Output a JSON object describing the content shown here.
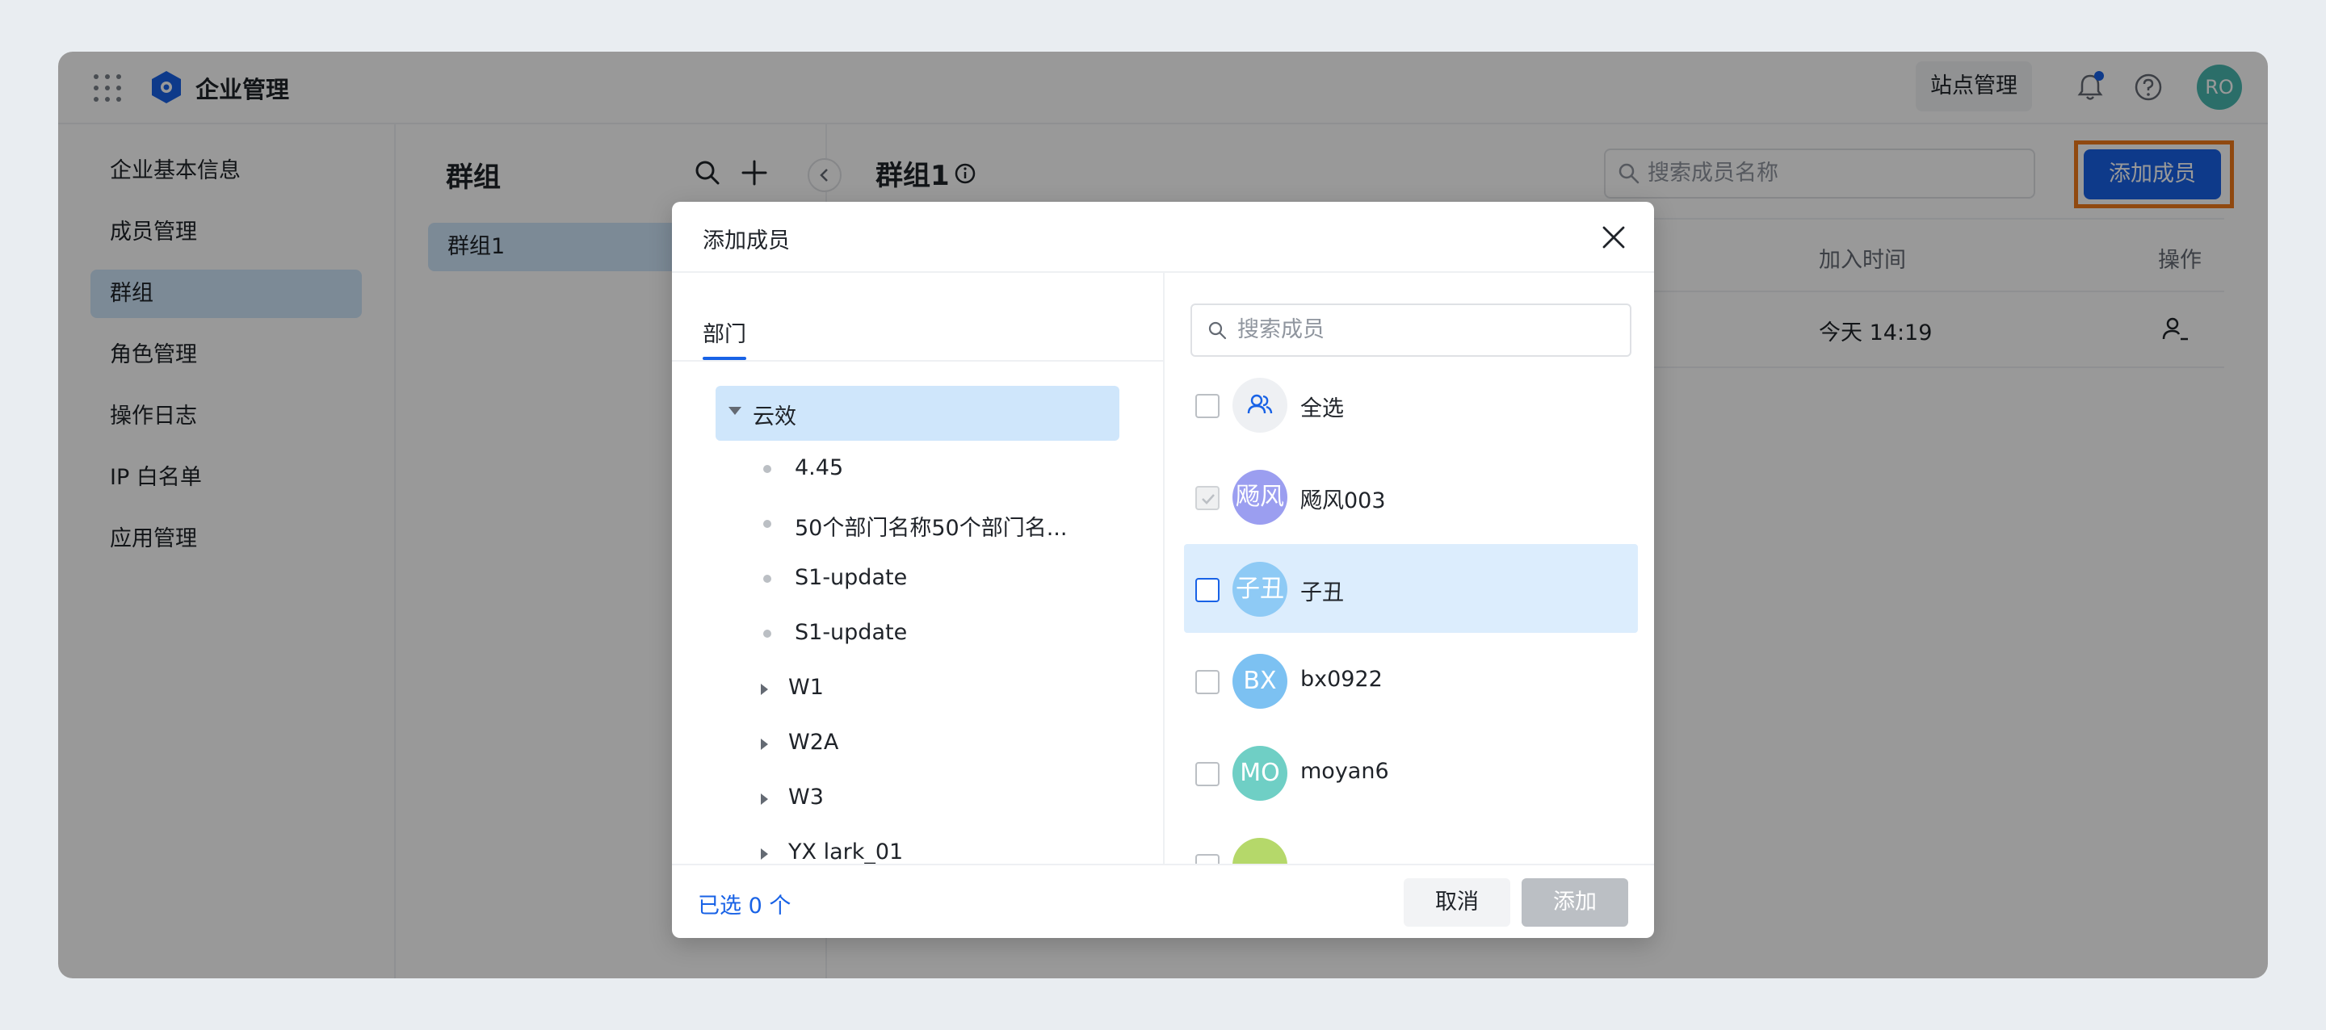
{
  "header": {
    "app_title": "企业管理",
    "site_button": "站点管理",
    "avatar_initials": "RO",
    "avatar_color": "#48b8b0",
    "brand_color": "#1862e6"
  },
  "sidebar": {
    "items": [
      {
        "label": "企业基本信息"
      },
      {
        "label": "成员管理"
      },
      {
        "label": "群组"
      },
      {
        "label": "角色管理"
      },
      {
        "label": "操作日志"
      },
      {
        "label": "IP 白名单"
      },
      {
        "label": "应用管理"
      }
    ],
    "active_index": 2
  },
  "groups": {
    "title": "群组",
    "items": [
      {
        "label": "群组1"
      }
    ]
  },
  "main": {
    "title": "群组1",
    "search_placeholder": "搜索成员名称",
    "add_member_button": "添加成员",
    "columns": {
      "join_time": "加入时间",
      "action": "操作"
    },
    "rows": [
      {
        "join_time": "今天 14:19"
      }
    ]
  },
  "modal": {
    "title": "添加成员",
    "tab_label": "部门",
    "tree": {
      "root": "云效",
      "children": [
        {
          "label": "4.45",
          "type": "leaf"
        },
        {
          "label": "50个部门名称50个部门名...",
          "type": "leaf"
        },
        {
          "label": "S1-update",
          "type": "leaf"
        },
        {
          "label": "S1-update",
          "type": "leaf"
        },
        {
          "label": "W1",
          "type": "branch"
        },
        {
          "label": "W2A",
          "type": "branch"
        },
        {
          "label": "W3",
          "type": "branch"
        },
        {
          "label": "YX lark_01",
          "type": "branch"
        }
      ]
    },
    "search_placeholder": "搜索成员",
    "select_all": "全选",
    "members": [
      {
        "avatar": "飏风",
        "name": "飏风003",
        "color": "#9b9ef0",
        "disabled": true
      },
      {
        "avatar": "子丑",
        "name": "子丑",
        "color": "#8ecaf5",
        "highlighted": true
      },
      {
        "avatar": "BX",
        "name": "bx0922",
        "color": "#7cc1f2"
      },
      {
        "avatar": "MO",
        "name": "moyan6",
        "color": "#6fcfc5"
      },
      {
        "avatar": "",
        "name": "",
        "color": "#b5d86a"
      }
    ],
    "selected_count": "已选 0 个",
    "cancel_button": "取消",
    "add_button": "添加"
  }
}
